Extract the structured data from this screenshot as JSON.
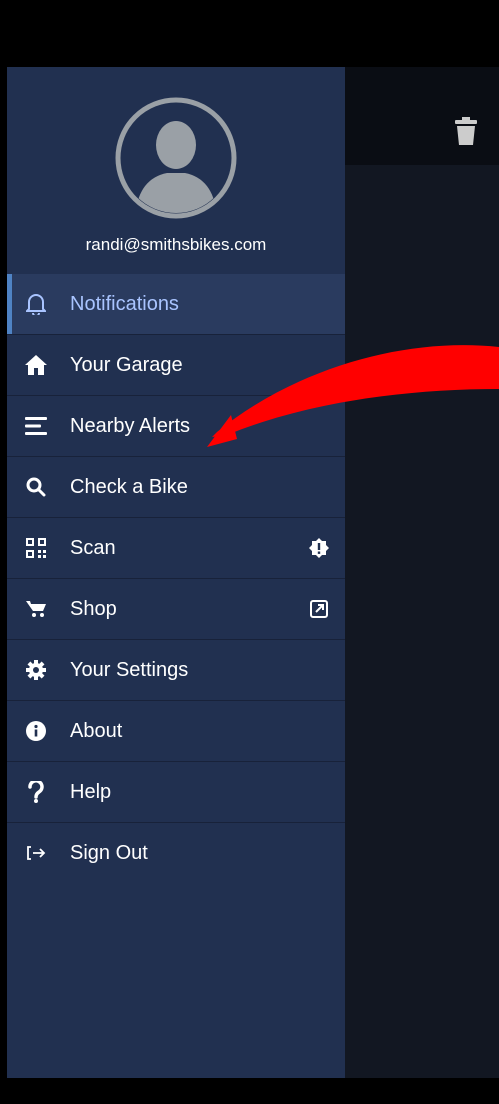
{
  "user": {
    "email": "randi@smithsbikes.com"
  },
  "menu": {
    "items": [
      {
        "label": "Notifications",
        "icon": "bell-icon",
        "active": true
      },
      {
        "label": "Your Garage",
        "icon": "home-icon"
      },
      {
        "label": "Nearby Alerts",
        "icon": "list-icon"
      },
      {
        "label": "Check a Bike",
        "icon": "search-icon"
      },
      {
        "label": "Scan",
        "icon": "qr-code-icon",
        "badge_icon": "alert-badge-icon"
      },
      {
        "label": "Shop",
        "icon": "cart-icon",
        "badge_icon": "external-link-icon"
      },
      {
        "label": "Your Settings",
        "icon": "gear-icon"
      },
      {
        "label": "About",
        "icon": "info-icon"
      },
      {
        "label": "Help",
        "icon": "question-icon"
      },
      {
        "label": "Sign Out",
        "icon": "sign-out-icon"
      }
    ]
  },
  "colors": {
    "drawer_bg": "#213050",
    "active_bg": "#2a3b5f",
    "active_accent": "#4f83c4",
    "active_text": "#a9c4ff",
    "annotation_arrow": "#ff0000"
  }
}
